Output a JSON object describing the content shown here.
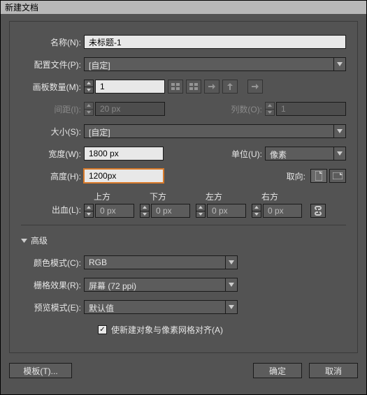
{
  "title": "新建文档",
  "fields": {
    "name_label": "名称(N):",
    "name_value": "未标题-1",
    "profile_label": "配置文件(P):",
    "profile_value": "[自定]",
    "artboards_label": "画板数量(M):",
    "artboards_value": "1",
    "spacing_label": "间距(I):",
    "spacing_value": "20 px",
    "columns_label": "列数(O):",
    "columns_value": "1",
    "size_label": "大小(S):",
    "size_value": "[自定]",
    "width_label": "宽度(W):",
    "width_value": "1800 px",
    "units_label": "单位(U):",
    "units_value": "像素",
    "height_label": "高度(H):",
    "height_value": "1200px",
    "orient_label": "取向:",
    "bleed_label": "出血(L):",
    "bleed_top": "上方",
    "bleed_bottom": "下方",
    "bleed_left": "左方",
    "bleed_right": "右方",
    "bleed_value": "0 px"
  },
  "advanced": {
    "title": "高级",
    "color_label": "颜色模式(C):",
    "color_value": "RGB",
    "raster_label": "栅格效果(R):",
    "raster_value": "屏幕 (72 ppi)",
    "preview_label": "预览模式(E):",
    "preview_value": "默认值",
    "align_label": "使新建对象与像素网格对齐(A)"
  },
  "buttons": {
    "template": "模板(T)...",
    "ok": "确定",
    "cancel": "取消"
  }
}
